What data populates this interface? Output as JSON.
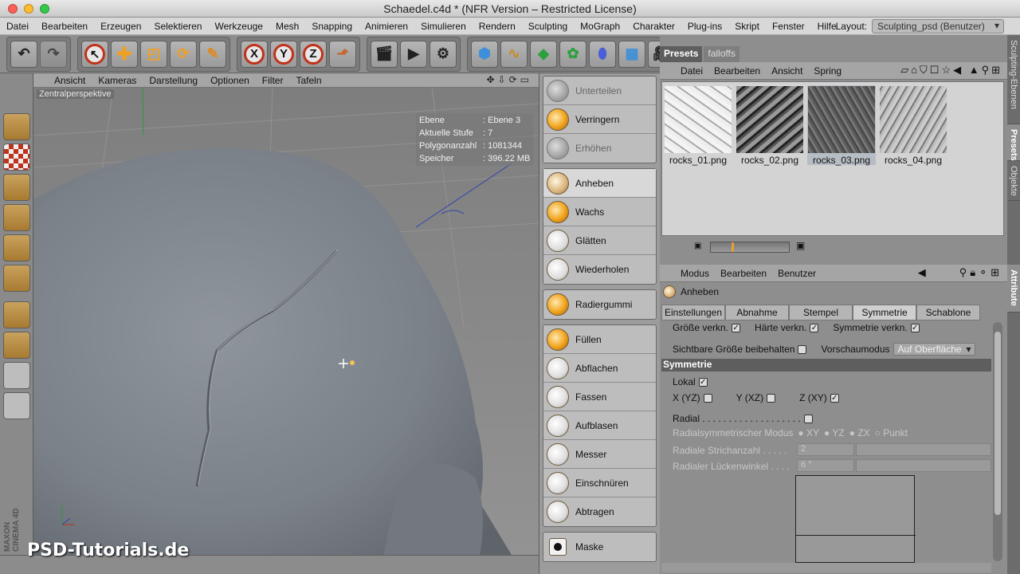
{
  "window": {
    "title": "Schaedel.c4d * (NFR Version – Restricted License)"
  },
  "menu": [
    "Datei",
    "Bearbeiten",
    "Erzeugen",
    "Selektieren",
    "Werkzeuge",
    "Mesh",
    "Snapping",
    "Animieren",
    "Simulieren",
    "Rendern",
    "Sculpting",
    "MoGraph",
    "Charakter",
    "Plug-ins",
    "Skript",
    "Fenster",
    "Hilfe"
  ],
  "layout": {
    "label": "Layout:",
    "value": "Sculpting_psd (Benutzer)"
  },
  "toolbar": {
    "x": "X",
    "y": "Y",
    "z": "Z"
  },
  "viewport": {
    "menu": [
      "Ansicht",
      "Kameras",
      "Darstellung",
      "Optionen",
      "Filter",
      "Tafeln"
    ],
    "label": "Zentralperspektive",
    "hud": [
      {
        "k": "Ebene",
        "v": ": Ebene 3"
      },
      {
        "k": "Aktuelle Stufe",
        "v": ": 7"
      },
      {
        "k": "Polygonanzahl",
        "v": ": 1081344"
      },
      {
        "k": "Speicher",
        "v": ": 396.22 MB"
      }
    ],
    "watermark": "PSD-Tutorials.de",
    "brand": "MAXON CINEMA 4D"
  },
  "sculpt_tools": {
    "group1": [
      "Unterteilen",
      "Verringern",
      "Erhöhen"
    ],
    "group2": [
      "Anheben",
      "Wachs",
      "Glätten",
      "Wiederholen"
    ],
    "group3": [
      "Radiergummi"
    ],
    "group4": [
      "Füllen",
      "Abflachen",
      "Fassen",
      "Aufblasen",
      "Messer",
      "Einschnüren",
      "Abtragen"
    ],
    "group5": [
      "Maske"
    ]
  },
  "presets": {
    "tabs": [
      "Presets",
      "falloffs"
    ],
    "menu": [
      "Datei",
      "Bearbeiten",
      "Ansicht",
      "Spring"
    ],
    "thumbs": [
      "rocks_01.png",
      "rocks_02.png",
      "rocks_03.png",
      "rocks_04.png"
    ],
    "selected": "rocks_03.png"
  },
  "side_tabs": [
    "Sculpting-Ebenen",
    "Presets",
    "Objekte",
    "Attribute"
  ],
  "attributes": {
    "menu": [
      "Modus",
      "Bearbeiten",
      "Benutzer"
    ],
    "title": "Anheben",
    "tabs": [
      "Einstellungen",
      "Abnahme",
      "Stempel",
      "Symmetrie",
      "Schablone"
    ],
    "active_tab": "Symmetrie",
    "row1": [
      "Größe verkn.",
      "Härte verkn.",
      "Symmetrie verkn."
    ],
    "row2_label": "Sichtbare Größe beibehalten",
    "preview_label": "Vorschaumodus",
    "preview_value": "Auf Oberfläche",
    "section": "Symmetrie",
    "lokal": "Lokal",
    "axes": [
      "X (YZ)",
      "Y (XZ)",
      "Z (XY)"
    ],
    "radial": "Radial . . . . . . . . . . . . . . . . . . .",
    "radial_mode": "Radialsymmetrischer Modus",
    "radial_options": [
      "XY",
      "YZ",
      "ZX",
      "Punkt"
    ],
    "strokes_label": "Radiale Strichanzahl . . . . .",
    "strokes_value": "2",
    "gap_label": "Radialer Lückenwinkel . . . .",
    "gap_value": "6 °"
  }
}
